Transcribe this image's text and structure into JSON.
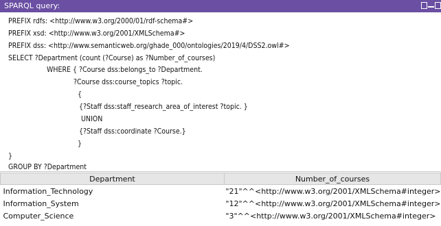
{
  "window": {
    "title": "SPARQL query:"
  },
  "query": {
    "lines": [
      "PREFIX rdfs: <http://www.w3.org/2000/01/rdf-schema#>",
      "PREFIX xsd: <http://www.w3.org/2001/XMLSchema#>",
      "PREFIX dss: <http://www.semanticweb.org/ghade_000/ontologies/2019/4/DSS2.owl#>",
      "SELECT ?Department (count (?Course) as ?Number_of_courses)",
      "WHERE { ?Course dss:belongs_to ?Department.",
      "?Course dss:course_topics ?topic.",
      "{",
      "{?Staff dss:staff_research_area_of_interest ?topic. }",
      "UNION",
      "{?Staff dss:coordinate ?Course.}",
      "}",
      "}",
      "GROUP BY ?Department"
    ]
  },
  "results": {
    "columns": [
      "Department",
      "Number_of_courses"
    ],
    "rows": [
      [
        "Information_Technology",
        "\"21\"^^<http://www.w3.org/2001/XMLSchema#integer>"
      ],
      [
        "Information_System",
        "\"12\"^^<http://www.w3.org/2001/XMLSchema#integer>"
      ],
      [
        "Computer_Science",
        "\"3\"^^<http://www.w3.org/2001/XMLSchema#integer>"
      ]
    ]
  }
}
